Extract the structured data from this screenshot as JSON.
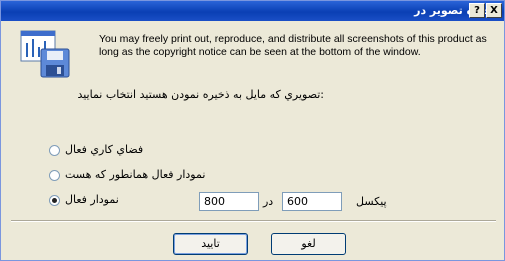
{
  "window": {
    "title": "ذخيره تصوير در",
    "help_label": "?",
    "close_label": "X"
  },
  "info_text": "You may freely print out, reproduce, and distribute all screenshots of this product as long as the copyright notice can be seen at the bottom of the window.",
  "prompt": ":تصويري که مايل به ذخيره نمودن هستيد انتخاب نماييد",
  "options": [
    {
      "label": "فضاي کاري فعال",
      "selected": false
    },
    {
      "label": "نمودار فعال همانطور که هست",
      "selected": false
    },
    {
      "label": "نمودار فعال",
      "selected": true
    }
  ],
  "size": {
    "width_value": "800",
    "separator": "در",
    "height_value": "600",
    "unit": "پيکسل"
  },
  "buttons": {
    "ok": "تاييد",
    "cancel": "لغو"
  },
  "colors": {
    "titlebar": "#0a3fb4",
    "background": "#ece9d8"
  }
}
